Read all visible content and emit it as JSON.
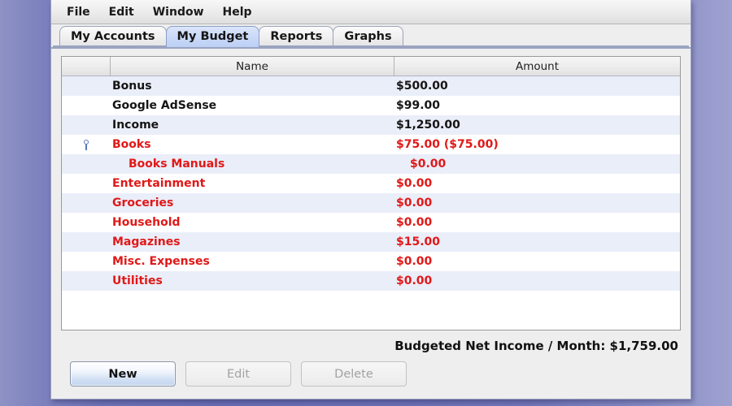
{
  "window": {
    "menubar": {
      "items": [
        {
          "label": "File"
        },
        {
          "label": "Edit"
        },
        {
          "label": "Window"
        },
        {
          "label": "Help"
        }
      ]
    },
    "tabs": [
      {
        "label": "My Accounts",
        "selected": false
      },
      {
        "label": "My Budget",
        "selected": true
      },
      {
        "label": "Reports",
        "selected": false
      },
      {
        "label": "Graphs",
        "selected": false
      }
    ]
  },
  "table": {
    "columns": [
      {
        "label": ""
      },
      {
        "label": "Name"
      },
      {
        "label": "Amount"
      }
    ],
    "rows": [
      {
        "handle": false,
        "indent": 0,
        "name": "Bonus",
        "amount": "$500.00",
        "type": "income",
        "stripe": true
      },
      {
        "handle": false,
        "indent": 0,
        "name": "Google AdSense",
        "amount": "$99.00",
        "type": "income",
        "stripe": false
      },
      {
        "handle": false,
        "indent": 0,
        "name": "Income",
        "amount": "$1,250.00",
        "type": "income",
        "stripe": true
      },
      {
        "handle": true,
        "indent": 0,
        "name": "Books",
        "amount": "$75.00 ($75.00)",
        "type": "expense",
        "stripe": false
      },
      {
        "handle": false,
        "indent": 1,
        "name": "Books Manuals",
        "amount": "$0.00",
        "type": "expense",
        "stripe": true
      },
      {
        "handle": false,
        "indent": 0,
        "name": "Entertainment",
        "amount": "$0.00",
        "type": "expense",
        "stripe": false
      },
      {
        "handle": false,
        "indent": 0,
        "name": "Groceries",
        "amount": "$0.00",
        "type": "expense",
        "stripe": true
      },
      {
        "handle": false,
        "indent": 0,
        "name": "Household",
        "amount": "$0.00",
        "type": "expense",
        "stripe": false
      },
      {
        "handle": false,
        "indent": 0,
        "name": "Magazines",
        "amount": "$15.00",
        "type": "expense",
        "stripe": true
      },
      {
        "handle": false,
        "indent": 0,
        "name": "Misc. Expenses",
        "amount": "$0.00",
        "type": "expense",
        "stripe": false
      },
      {
        "handle": false,
        "indent": 0,
        "name": "Utilities",
        "amount": "$0.00",
        "type": "expense",
        "stripe": true
      }
    ]
  },
  "summary": {
    "text": "Budgeted Net Income / Month: $1,759.00"
  },
  "buttons": [
    {
      "label": "New",
      "state": "primary"
    },
    {
      "label": "Edit",
      "state": "disabled"
    },
    {
      "label": "Delete",
      "state": "disabled"
    }
  ],
  "colors": {
    "expense": "#e11818",
    "income": "#151515",
    "stripe": "#eaeef9",
    "selected_tab": "#c8d8f7",
    "desktop": "#6f73b6"
  }
}
